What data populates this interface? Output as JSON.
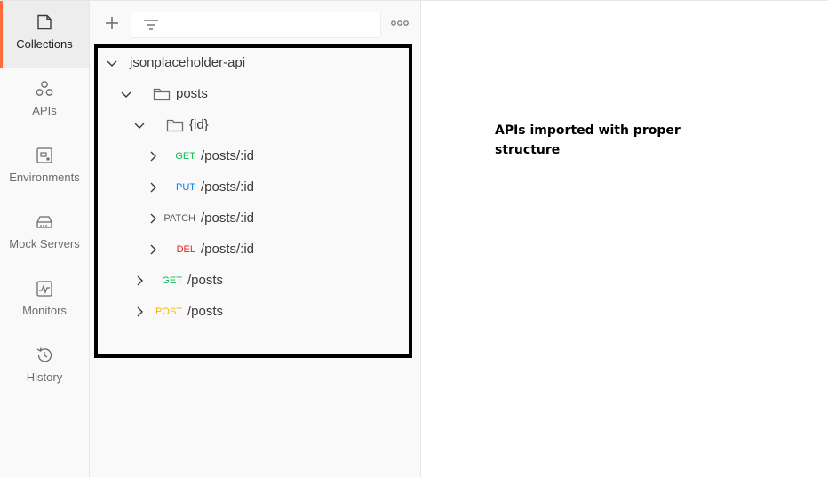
{
  "nav": [
    {
      "label": "Collections",
      "icon": "collections-icon",
      "active": true
    },
    {
      "label": "APIs",
      "icon": "apis-icon",
      "active": false
    },
    {
      "label": "Environments",
      "icon": "environments-icon",
      "active": false
    },
    {
      "label": "Mock Servers",
      "icon": "mock-servers-icon",
      "active": false
    },
    {
      "label": "Monitors",
      "icon": "monitors-icon",
      "active": false
    },
    {
      "label": "History",
      "icon": "history-icon",
      "active": false
    }
  ],
  "toolbar": {
    "add_icon": "plus-icon",
    "filter_icon": "filter-icon",
    "more_icon": "more-options-icon"
  },
  "tree": {
    "collection": "jsonplaceholder-api",
    "folder_posts": "posts",
    "folder_id": "{id}",
    "requests": [
      {
        "method": "GET",
        "path": "/posts/:id"
      },
      {
        "method": "PUT",
        "path": "/posts/:id"
      },
      {
        "method": "PATCH",
        "path": "/posts/:id"
      },
      {
        "method": "DEL",
        "path": "/posts/:id"
      },
      {
        "method": "GET",
        "path": "/posts"
      },
      {
        "method": "POST",
        "path": "/posts"
      }
    ]
  },
  "colors": {
    "accent": "#ff6c37",
    "get": "#0cbb52",
    "put": "#097bed",
    "patch": "#5e5e5e",
    "delete": "#eb2013",
    "post": "#ffb400"
  },
  "annotation": {
    "line1": "APIs imported with proper",
    "line2": "structure"
  }
}
